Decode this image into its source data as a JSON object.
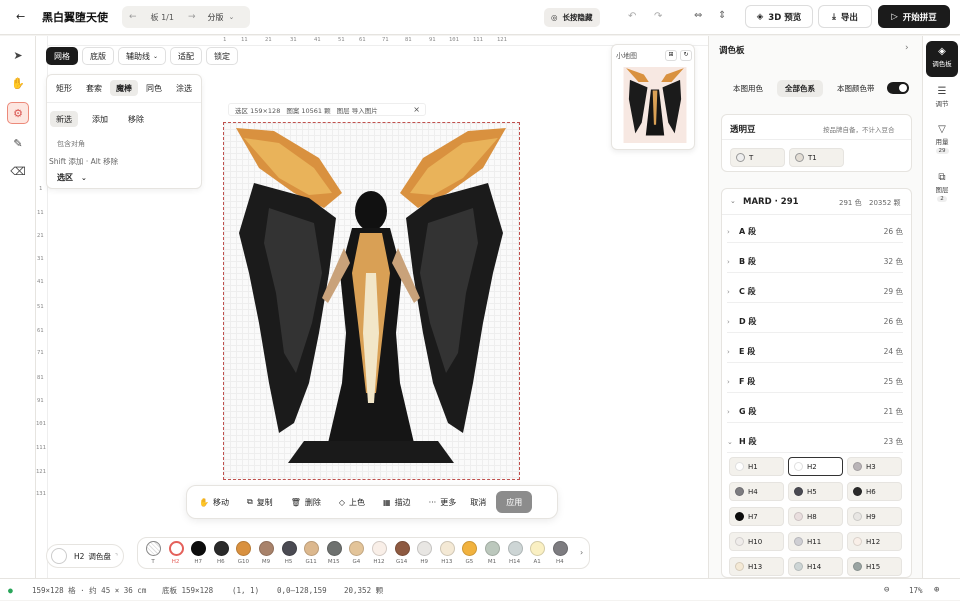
{
  "topbar": {
    "title": "黑白翼堕天使",
    "board": "板 1/1",
    "split": "分版",
    "hide_label": "长按隐藏",
    "preview_3d": "3D 预览",
    "export": "导出",
    "start": "开始拼豆"
  },
  "left_rail": {
    "icons": [
      "pointer-icon",
      "hand-icon",
      "magic-wand-icon",
      "eyedropper-icon",
      "eraser-icon"
    ]
  },
  "ruler": {
    "top": [
      "1",
      "11",
      "21",
      "31",
      "41",
      "51",
      "61",
      "71",
      "81",
      "91",
      "101",
      "111",
      "121"
    ],
    "left": [
      "1",
      "11",
      "21",
      "31",
      "41",
      "51",
      "61",
      "71",
      "81",
      "91",
      "101",
      "111",
      "121",
      "131",
      "141",
      "151"
    ]
  },
  "toolbar": {
    "items": [
      "网格",
      "底版",
      "辅助线",
      "适配",
      "锁定"
    ]
  },
  "select_panel": {
    "modes": [
      "矩形",
      "套索",
      "魔棒",
      "同色",
      "涂选"
    ],
    "ops": [
      "新选",
      "添加",
      "移除"
    ],
    "contiguous": "包含对角",
    "hint": "Shift 添加 · Alt 移除",
    "selection": "选区"
  },
  "info": {
    "selection": "选区 159×128",
    "beads": "图案 10561 颗",
    "layer": "图层 导入图片"
  },
  "minimap": {
    "title": "小地图"
  },
  "floating": {
    "move": "移动",
    "copy": "复制",
    "delete": "删除",
    "colorize": "上色",
    "outline": "描边",
    "more": "更多",
    "cancel": "取消",
    "apply": "应用"
  },
  "current_color": {
    "code": "H2",
    "label": "调色盘"
  },
  "swatches": [
    {
      "code": "T",
      "color": "#ffffff"
    },
    {
      "code": "H2",
      "color": "#ffffff"
    },
    {
      "code": "H7",
      "color": "#0c0c0c"
    },
    {
      "code": "H6",
      "color": "#2a2a2a"
    },
    {
      "code": "G10",
      "color": "#d9913f"
    },
    {
      "code": "M9",
      "color": "#a8826a"
    },
    {
      "code": "H5",
      "color": "#4a4a52"
    },
    {
      "code": "G11",
      "color": "#dcb88e"
    },
    {
      "code": "M15",
      "color": "#6e716f"
    },
    {
      "code": "G4",
      "color": "#e3c499"
    },
    {
      "code": "H12",
      "color": "#f9efe8"
    },
    {
      "code": "G14",
      "color": "#8e5a41"
    },
    {
      "code": "H9",
      "color": "#e8e6e3"
    },
    {
      "code": "H13",
      "color": "#f4e9d5"
    },
    {
      "code": "G5",
      "color": "#f1b23e"
    },
    {
      "code": "M1",
      "color": "#bcc8bd"
    },
    {
      "code": "H14",
      "color": "#cdd5d5"
    },
    {
      "code": "A1",
      "color": "#faf0c3"
    },
    {
      "code": "H4",
      "color": "#7d7c80"
    }
  ],
  "status": {
    "grid_size": "159×128 格 · 约 45 × 36 cm",
    "base": "底板 159×128",
    "cursor": "(1, 1)",
    "range": "0,0–128,159",
    "count": "20,352 颗",
    "zoom": "17%"
  },
  "right_panel": {
    "title": "调色板",
    "tabs": [
      "本图用色",
      "全部色系",
      "本图颜色带"
    ],
    "transparent": {
      "title": "透明豆",
      "note": "按品牌自备，不计入豆合",
      "items": [
        "T",
        "T1"
      ]
    },
    "brand": {
      "name": "MARD · 291",
      "colors": "291 色",
      "beads": "20352 颗"
    },
    "segments": [
      {
        "label": "A 段",
        "count": "26 色"
      },
      {
        "label": "B 段",
        "count": "32 色"
      },
      {
        "label": "C 段",
        "count": "29 色"
      },
      {
        "label": "D 段",
        "count": "26 色"
      },
      {
        "label": "E 段",
        "count": "24 色"
      },
      {
        "label": "F 段",
        "count": "25 色"
      },
      {
        "label": "G 段",
        "count": "21 色"
      },
      {
        "label": "H 段",
        "count": "23 色"
      }
    ],
    "h_colors": [
      {
        "code": "H1",
        "color": "#ffffff"
      },
      {
        "code": "H2",
        "color": "#ffffff"
      },
      {
        "code": "H3",
        "color": "#b9b4b7"
      },
      {
        "code": "H4",
        "color": "#7d7c80"
      },
      {
        "code": "H5",
        "color": "#4a4a52"
      },
      {
        "code": "H6",
        "color": "#2a2a2a"
      },
      {
        "code": "H7",
        "color": "#0c0c0c"
      },
      {
        "code": "H8",
        "color": "#e9dede"
      },
      {
        "code": "H9",
        "color": "#e8e6e3"
      },
      {
        "code": "H10",
        "color": "#efecea"
      },
      {
        "code": "H11",
        "color": "#cfcfd4"
      },
      {
        "code": "H12",
        "color": "#f9efe8"
      },
      {
        "code": "H13",
        "color": "#f4e9d5"
      },
      {
        "code": "H14",
        "color": "#cdd5d5"
      },
      {
        "code": "H15",
        "color": "#9aa4a2"
      }
    ]
  },
  "right_rail": {
    "items": [
      {
        "label": "调色板"
      },
      {
        "label": "调节"
      },
      {
        "label": "用量",
        "badge": "29"
      },
      {
        "label": "图层",
        "badge": "2"
      }
    ]
  }
}
